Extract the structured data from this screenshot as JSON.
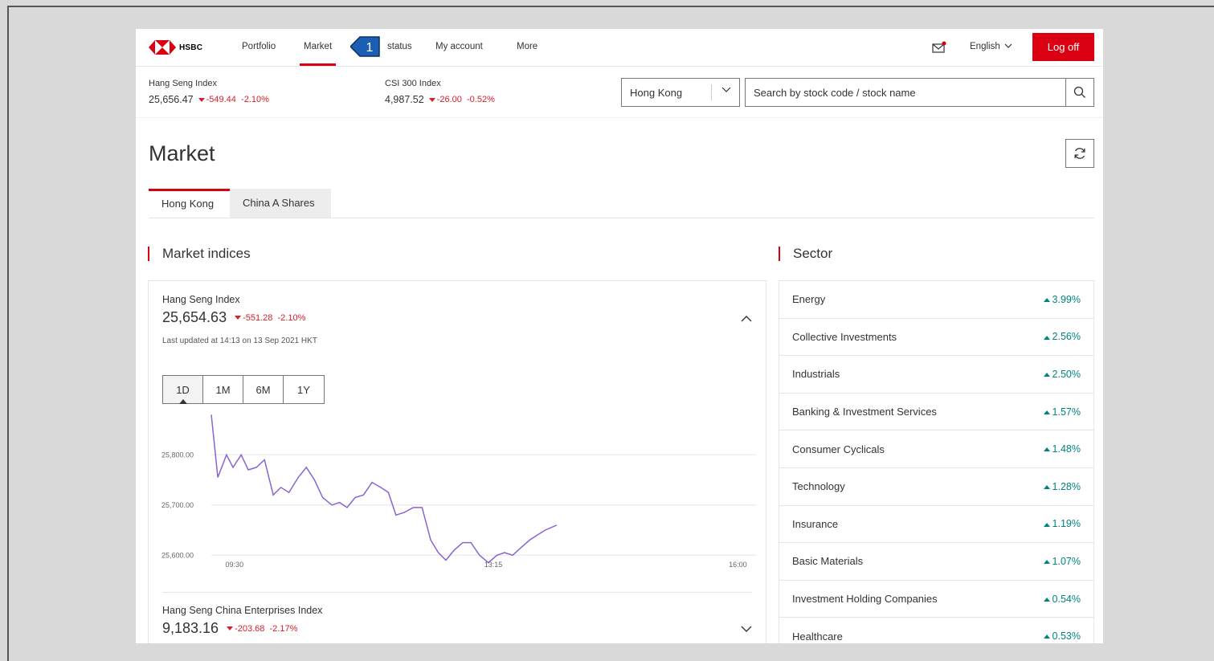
{
  "nav": {
    "logo_text": "HSBC",
    "items": [
      {
        "label": "Portfolio"
      },
      {
        "label": "Market"
      },
      {
        "label": "status"
      },
      {
        "label": "My account"
      },
      {
        "label": "More"
      }
    ],
    "marker_number": "1",
    "language": "English",
    "logoff": "Log off"
  },
  "ticker": {
    "hsi": {
      "name": "Hang Seng Index",
      "value": "25,656.47",
      "change": "-549.44",
      "pct": "-2.10%"
    },
    "csi": {
      "name": "CSI 300 Index",
      "value": "4,987.52",
      "change": "-26.00",
      "pct": "-0.52%"
    }
  },
  "search": {
    "region": "Hong Kong",
    "placeholder": "Search by stock code / stock name"
  },
  "page": {
    "title": "Market",
    "tabs": [
      {
        "label": "Hong Kong"
      },
      {
        "label": "China A Shares"
      }
    ]
  },
  "indices": {
    "heading": "Market indices",
    "primary": {
      "name": "Hang Seng Index",
      "value": "25,654.63",
      "change": "-551.28",
      "pct": "-2.10%",
      "updated": "Last updated at 14:13 on 13 Sep 2021 HKT"
    },
    "periods": [
      "1D",
      "1M",
      "6M",
      "1Y"
    ],
    "secondary": {
      "name": "Hang Seng China Enterprises Index",
      "value": "9,183.16",
      "change": "-203.68",
      "pct": "-2.17%"
    }
  },
  "chart_data": {
    "type": "line",
    "y_ticks": [
      "25,800.00",
      "25,700.00",
      "25,600.00"
    ],
    "x_ticks": [
      "09:30",
      "13:15",
      "16:00"
    ],
    "ylim": [
      25570,
      25890
    ],
    "series": [
      {
        "color": "#8a63d2",
        "x_fraction": [
          0.0,
          0.012,
          0.028,
          0.04,
          0.055,
          0.068,
          0.083,
          0.098,
          0.114,
          0.128,
          0.143,
          0.16,
          0.175,
          0.19,
          0.205,
          0.222,
          0.236,
          0.25,
          0.265,
          0.28,
          0.296,
          0.312,
          0.326,
          0.34,
          0.355,
          0.372,
          0.388,
          0.404,
          0.418,
          0.432,
          0.447,
          0.463,
          0.478,
          0.494,
          0.51,
          0.526,
          0.54,
          0.555,
          0.57,
          0.586,
          0.6,
          0.615,
          0.636
        ],
        "values": [
          25880,
          25755,
          25800,
          25775,
          25800,
          25770,
          25775,
          25790,
          25720,
          25735,
          25725,
          25755,
          25775,
          25750,
          25715,
          25700,
          25705,
          25695,
          25715,
          25720,
          25745,
          25735,
          25725,
          25680,
          25685,
          25695,
          25695,
          25630,
          25605,
          25590,
          25610,
          25625,
          25625,
          25600,
          25585,
          25600,
          25605,
          25600,
          25615,
          25630,
          25640,
          25650,
          25660
        ]
      }
    ]
  },
  "sector": {
    "heading": "Sector",
    "rows": [
      {
        "name": "Energy",
        "pct": "3.99%"
      },
      {
        "name": "Collective Investments",
        "pct": "2.56%"
      },
      {
        "name": "Industrials",
        "pct": "2.50%"
      },
      {
        "name": "Banking & Investment Services",
        "pct": "1.57%"
      },
      {
        "name": "Consumer Cyclicals",
        "pct": "1.48%"
      },
      {
        "name": "Technology",
        "pct": "1.28%"
      },
      {
        "name": "Insurance",
        "pct": "1.19%"
      },
      {
        "name": "Basic Materials",
        "pct": "1.07%"
      },
      {
        "name": "Investment Holding Companies",
        "pct": "0.54%"
      },
      {
        "name": "Healthcare",
        "pct": "0.53%"
      }
    ]
  },
  "colors": {
    "brand_red": "#db0011",
    "negative": "#d71e28",
    "positive": "#00847f",
    "chart_line": "#8a63d2",
    "marker_blue": "#1a5fb4"
  }
}
